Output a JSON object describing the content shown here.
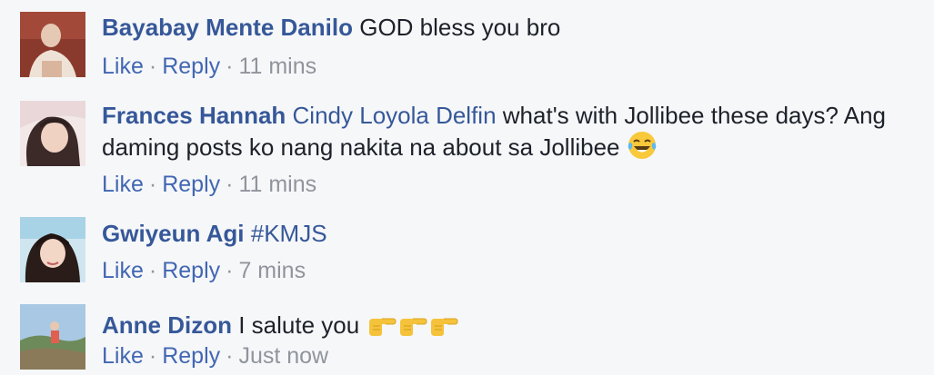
{
  "comments": [
    {
      "author": "Bayabay Mente Danilo",
      "text": "GOD bless you bro",
      "like_label": "Like",
      "reply_label": "Reply",
      "time": "11 mins"
    },
    {
      "author": "Frances Hannah",
      "mention": "Cindy Loyola Delfin",
      "text_line1": "what's with Jollibee these days? Ang",
      "text_line2": "daming posts ko nang nakita na about sa Jollibee",
      "emoji": "face-with-tears-of-joy",
      "like_label": "Like",
      "reply_label": "Reply",
      "time": "11 mins"
    },
    {
      "author": "Gwiyeun Agi",
      "text": "#KMJS",
      "like_label": "Like",
      "reply_label": "Reply",
      "time": "7 mins"
    },
    {
      "author": "Anne Dizon",
      "text": "I salute you",
      "emoji": "backhand-index-pointing-right",
      "emoji_count": 3,
      "like_label": "Like",
      "reply_label": "Reply",
      "time": "Just now"
    }
  ],
  "separator": "·",
  "colors": {
    "background": "#f6f7f9",
    "author": "#365899",
    "link": "#4267b2",
    "meta": "#90949c",
    "text": "#1d2129"
  }
}
